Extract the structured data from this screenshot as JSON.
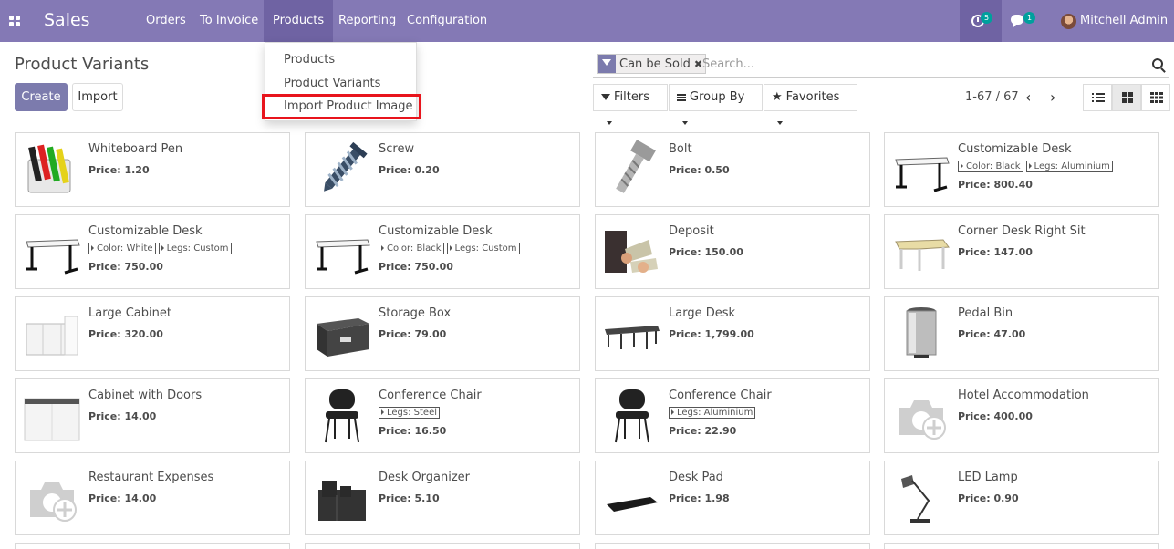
{
  "app": {
    "name": "Sales"
  },
  "topnav": {
    "menus": [
      "Orders",
      "To Invoice",
      "Products",
      "Reporting",
      "Configuration"
    ],
    "activity_count": "5",
    "message_count": "1",
    "user": "Mitchell Admin"
  },
  "dropdown": {
    "items": [
      "Products",
      "Product Variants",
      "Import Product Image"
    ]
  },
  "control": {
    "title": "Product Variants",
    "create_label": "Create",
    "import_label": "Import",
    "facet_label": "Can be Sold",
    "search_placeholder": "Search...",
    "filters_label": "Filters",
    "groupby_label": "Group By",
    "favorites_label": "Favorites",
    "pager": "1-67 / 67"
  },
  "products": [
    {
      "name": "Whiteboard Pen",
      "tags": [],
      "price": "Price: 1.20",
      "icon": "markers"
    },
    {
      "name": "Screw",
      "tags": [],
      "price": "Price: 0.20",
      "icon": "screw"
    },
    {
      "name": "Bolt",
      "tags": [],
      "price": "Price: 0.50",
      "icon": "bolt"
    },
    {
      "name": "Customizable Desk",
      "tags": [
        "Color: Black",
        "Legs: Aluminium"
      ],
      "price": "Price: 800.40",
      "icon": "desk"
    },
    {
      "name": "Customizable Desk",
      "tags": [
        "Color: White",
        "Legs: Custom"
      ],
      "price": "Price: 750.00",
      "icon": "desk"
    },
    {
      "name": "Customizable Desk",
      "tags": [
        "Color: Black",
        "Legs: Custom"
      ],
      "price": "Price: 750.00",
      "icon": "desk"
    },
    {
      "name": "Deposit",
      "tags": [],
      "price": "Price: 150.00",
      "icon": "money"
    },
    {
      "name": "Corner Desk Right Sit",
      "tags": [],
      "price": "Price: 147.00",
      "icon": "corner-desk"
    },
    {
      "name": "Large Cabinet",
      "tags": [],
      "price": "Price: 320.00",
      "icon": "cabinet"
    },
    {
      "name": "Storage Box",
      "tags": [],
      "price": "Price: 79.00",
      "icon": "box"
    },
    {
      "name": "Large Desk",
      "tags": [],
      "price": "Price: 1,799.00",
      "icon": "large-desk"
    },
    {
      "name": "Pedal Bin",
      "tags": [],
      "price": "Price: 47.00",
      "icon": "bin"
    },
    {
      "name": "Cabinet with Doors",
      "tags": [],
      "price": "Price: 14.00",
      "icon": "cabinet-doors"
    },
    {
      "name": "Conference Chair",
      "tags": [
        "Legs: Steel"
      ],
      "price": "Price: 16.50",
      "icon": "chair"
    },
    {
      "name": "Conference Chair",
      "tags": [
        "Legs: Aluminium"
      ],
      "price": "Price: 22.90",
      "icon": "chair"
    },
    {
      "name": "Hotel Accommodation",
      "tags": [],
      "price": "Price: 400.00",
      "icon": "placeholder"
    },
    {
      "name": "Restaurant Expenses",
      "tags": [],
      "price": "Price: 14.00",
      "icon": "placeholder"
    },
    {
      "name": "Desk Organizer",
      "tags": [],
      "price": "Price: 5.10",
      "icon": "organizer"
    },
    {
      "name": "Desk Pad",
      "tags": [],
      "price": "Price: 1.98",
      "icon": "pad"
    },
    {
      "name": "LED Lamp",
      "tags": [],
      "price": "Price: 0.90",
      "icon": "lamp"
    }
  ]
}
